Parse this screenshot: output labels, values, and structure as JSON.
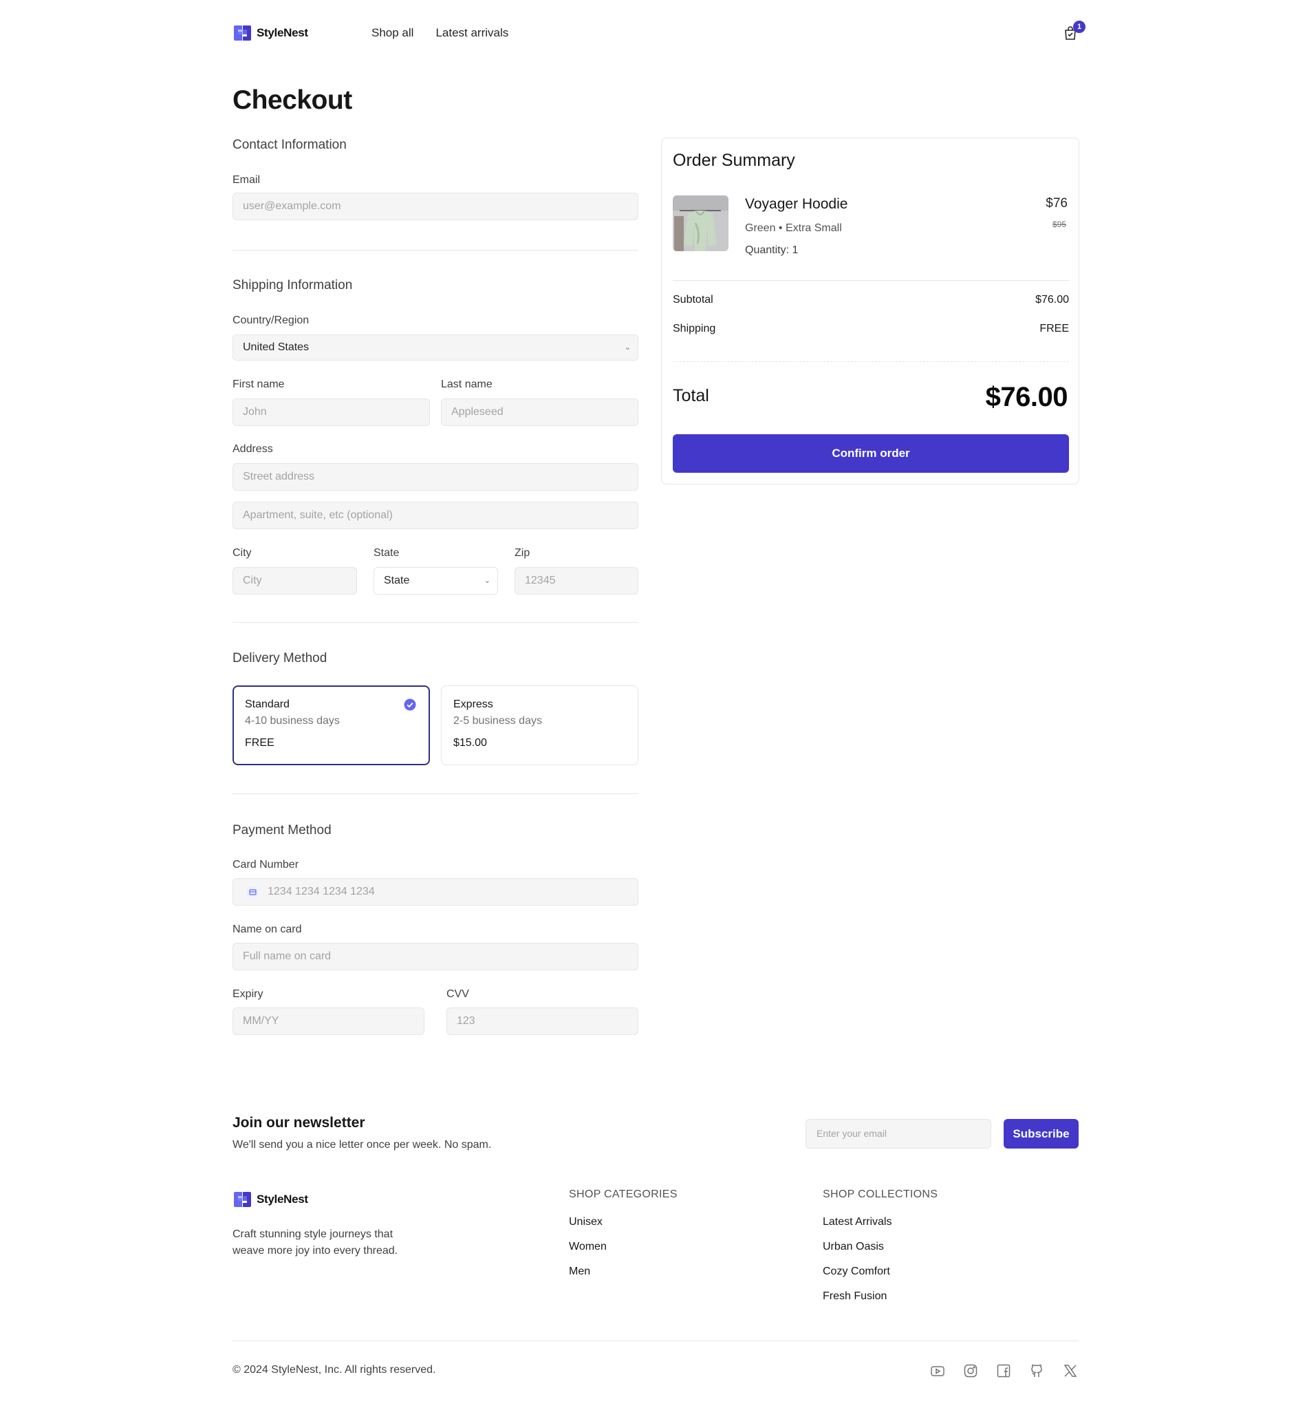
{
  "header": {
    "brand": "StyleNest",
    "nav": [
      "Shop all",
      "Latest arrivals"
    ],
    "cart_count": "1"
  },
  "page_title": "Checkout",
  "contact": {
    "title": "Contact Information",
    "email_label": "Email",
    "email_placeholder": "user@example.com"
  },
  "shipping": {
    "title": "Shipping Information",
    "country_label": "Country/Region",
    "country_value": "United States",
    "first_name_label": "First name",
    "first_name_placeholder": "John",
    "last_name_label": "Last name",
    "last_name_placeholder": "Appleseed",
    "address_label": "Address",
    "address_placeholder": "Street address",
    "address2_placeholder": "Apartment, suite, etc (optional)",
    "city_label": "City",
    "city_placeholder": "City",
    "state_label": "State",
    "state_value": "State",
    "zip_label": "Zip",
    "zip_placeholder": "12345"
  },
  "delivery": {
    "title": "Delivery Method",
    "options": [
      {
        "name": "Standard",
        "days": "4-10 business days",
        "price": "FREE",
        "selected": true
      },
      {
        "name": "Express",
        "days": "2-5 business days",
        "price": "$15.00",
        "selected": false
      }
    ]
  },
  "payment": {
    "title": "Payment Method",
    "card_label": "Card Number",
    "card_placeholder": "1234 1234 1234 1234",
    "name_label": "Name on card",
    "name_placeholder": "Full name on card",
    "expiry_label": "Expiry",
    "expiry_placeholder": "MM/YY",
    "cvv_label": "CVV",
    "cvv_placeholder": "123"
  },
  "summary": {
    "title": "Order Summary",
    "product": {
      "name": "Voyager Hoodie",
      "variant": "Green • Extra Small",
      "quantity": "Quantity: 1",
      "price": "$76",
      "compare_price": "$95"
    },
    "subtotal_label": "Subtotal",
    "subtotal_value": "$76.00",
    "shipping_label": "Shipping",
    "shipping_value": "FREE",
    "total_label": "Total",
    "total_value": "$76.00",
    "confirm_label": "Confirm order"
  },
  "newsletter": {
    "title": "Join our newsletter",
    "subtitle": "We'll send you a nice letter once per week. No spam.",
    "email_placeholder": "Enter your email",
    "button": "Subscribe"
  },
  "footer": {
    "brand": "StyleNest",
    "tagline": "Craft stunning style journeys that weave more joy into every thread.",
    "categories_title": "SHOP CATEGORIES",
    "categories": [
      "Unisex",
      "Women",
      "Men"
    ],
    "collections_title": "SHOP COLLECTIONS",
    "collections": [
      "Latest Arrivals",
      "Urban Oasis",
      "Cozy Comfort",
      "Fresh Fusion"
    ],
    "copyright": "© 2024 StyleNest, Inc. All rights reserved.",
    "social_icons": [
      "youtube-icon",
      "instagram-icon",
      "facebook-icon",
      "github-icon",
      "x-icon"
    ]
  },
  "colors": {
    "accent": "#4338ca",
    "selected_border": "#312e81",
    "input_bg": "#f5f5f5",
    "border": "#e5e5e5"
  }
}
